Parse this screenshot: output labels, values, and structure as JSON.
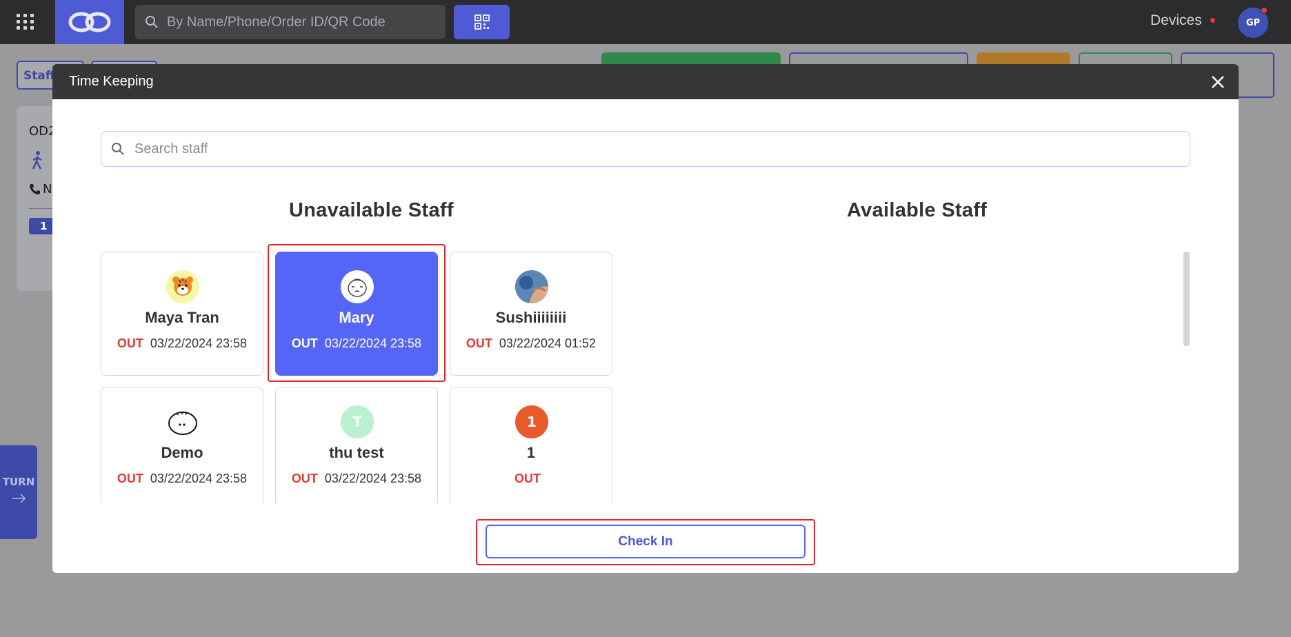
{
  "topbar": {
    "search_placeholder": "By Name/Phone/Order ID/QR Code",
    "devices_label": "Devices",
    "avatar_initials": "GP"
  },
  "background": {
    "staff_tab": "Staff",
    "order_prefix": "OD2",
    "phone_prefix": "N",
    "badge": "1",
    "turn_label": "TURN"
  },
  "modal": {
    "title": "Time Keeping",
    "search_placeholder": "Search staff",
    "unavailable_title": "Unavailable Staff",
    "available_title": "Available Staff",
    "check_in_label": "Check In",
    "staff": [
      {
        "name": "Maya Tran",
        "status": "OUT",
        "time": "03/22/2024 23:58",
        "avatar": "tiger-icon",
        "selected": false
      },
      {
        "name": "Mary",
        "status": "OUT",
        "time": "03/22/2024 23:58",
        "avatar": "cartoon-face-icon",
        "selected": true
      },
      {
        "name": "Sushiiiiiiii",
        "status": "OUT",
        "time": "03/22/2024 01:52",
        "avatar": "photo-avatar",
        "selected": false
      },
      {
        "name": "Demo",
        "status": "OUT",
        "time": "03/22/2024 23:58",
        "avatar": "round-face-icon",
        "selected": false
      },
      {
        "name": "thu test",
        "status": "OUT",
        "time": "03/22/2024 23:58",
        "avatar_initial": "T",
        "avatar_color": "#b9f0d0",
        "selected": false
      },
      {
        "name": "1",
        "status": "OUT",
        "time": "",
        "avatar_initial": "1",
        "avatar_color": "#e85a2a",
        "selected": false
      }
    ]
  },
  "colors": {
    "accent": "#5565f5",
    "out_status": "#e53935",
    "highlight_outline": "#e0202a"
  }
}
